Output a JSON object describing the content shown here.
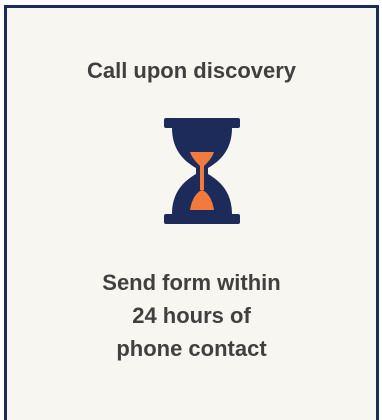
{
  "card": {
    "headline": "Call upon discovery",
    "instruction_lines": [
      "Send form within",
      "24 hours of",
      "phone contact"
    ],
    "icon": "hourglass-icon",
    "colors": {
      "border": "#1c2b5a",
      "background": "#f8f6f1",
      "hourglass_body": "#1c2b5a",
      "hourglass_sand": "#f27a3c",
      "text": "#404040"
    }
  }
}
